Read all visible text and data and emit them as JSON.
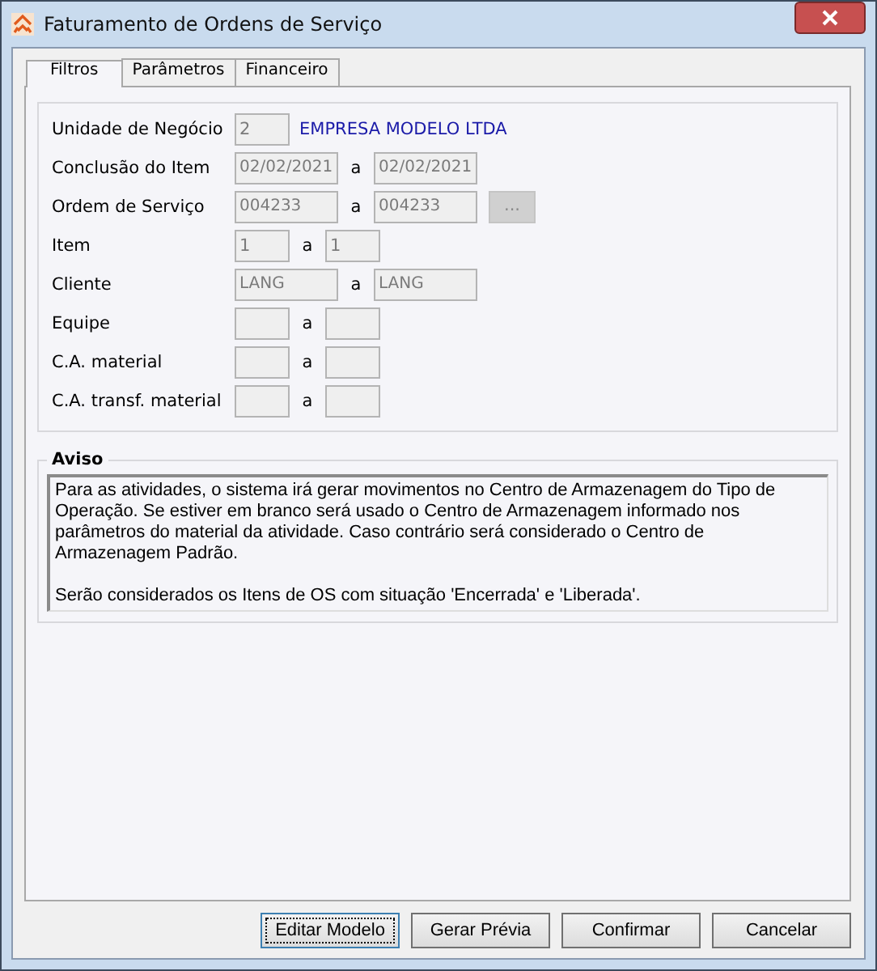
{
  "window": {
    "title": "Faturamento de Ordens de Serviço"
  },
  "tabs": [
    {
      "label": "Filtros",
      "selected": true
    },
    {
      "label": "Parâmetros",
      "selected": false
    },
    {
      "label": "Financeiro",
      "selected": false
    }
  ],
  "filters": [
    {
      "kind": "unit",
      "label": "Unidade de Negócio",
      "value": "2",
      "description": "EMPRESA MODELO LTDA"
    },
    {
      "kind": "range_wide",
      "label": "Conclusão do Item",
      "from": "02/02/2021",
      "separator": "a",
      "to": "02/02/2021"
    },
    {
      "kind": "range_wide",
      "label": "Ordem de Serviço",
      "from": "004233",
      "separator": "a",
      "to": "004233",
      "lookup_button": "..."
    },
    {
      "kind": "range_narrow",
      "label": "Item",
      "from": "1",
      "separator": "a",
      "to": "1"
    },
    {
      "kind": "range_wide",
      "label": "Cliente",
      "from": "LANG",
      "separator": "a",
      "to": "LANG"
    },
    {
      "kind": "range_narrow",
      "label": "Equipe",
      "separator": "a"
    },
    {
      "kind": "range_narrow",
      "label": "C.A. material",
      "separator": "a"
    },
    {
      "kind": "range_narrow",
      "label": "C.A. transf. material",
      "separator": "a"
    }
  ],
  "notice": {
    "title": "Aviso",
    "paragraphs": [
      "Para as atividades, o sistema irá gerar movimentos no Centro de Armazenagem do Tipo de Operação. Se estiver em branco será usado o Centro de Armazenagem informado nos parâmetros do material da atividade. Caso contrário será considerado o Centro de Armazenagem Padrão.",
      "Serão considerados os Itens de OS com situação 'Encerrada' e 'Liberada'."
    ]
  },
  "buttons": [
    {
      "label": "Editar Modelo",
      "selected": true
    },
    {
      "label": "Gerar Prévia",
      "selected": false
    },
    {
      "label": "Confirmar",
      "selected": false
    },
    {
      "label": "Cancelar",
      "selected": false
    }
  ]
}
